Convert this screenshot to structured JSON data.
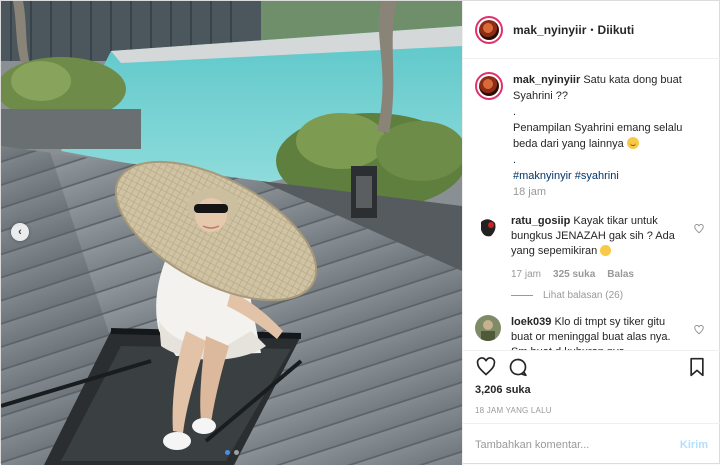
{
  "header": {
    "username": "mak_nyinyiir",
    "separator": "•",
    "follow_status": "Diikuti"
  },
  "caption": {
    "username": "mak_nyinyiir",
    "text": "Satu kata dong buat Syahrini ??",
    "dot1": ".",
    "line2": "Penampilan Syahrini emang selalu beda dari yang lainnya",
    "dot2": ".",
    "hashtags": "#maknyinyir #syahrini",
    "time": "18 jam"
  },
  "comments": [
    {
      "username": "ratu_gosiip",
      "text": "Kayak tikar untuk bungkus JENAZAH gak sih ? Ada yang sepemikiran",
      "time": "17 jam",
      "likes": "325 suka",
      "reply": "Balas",
      "replies": "Lihat balasan (26)"
    },
    {
      "username": "loek039",
      "text": "Klo di tmpt sy tiker gitu buat or meninggal buat alas nya. Sm buat d kuburan nya....."
    }
  ],
  "actions": {
    "like_count": "3,206 suka",
    "time_ago": "18 JAM YANG LALU"
  },
  "add_comment": {
    "placeholder": "Tambahkan komentar...",
    "send_label": "Kirim"
  },
  "colors": {
    "story_ring": "#e3306c",
    "hashtag": "#003569",
    "send_disabled": "#b2dffc",
    "active_dot": "#4a90e2"
  },
  "icons": {
    "nav_prev": "‹",
    "like": "heart-icon",
    "comment": "comment-icon",
    "save": "bookmark-icon",
    "comment_like": "heart-outline-icon"
  }
}
